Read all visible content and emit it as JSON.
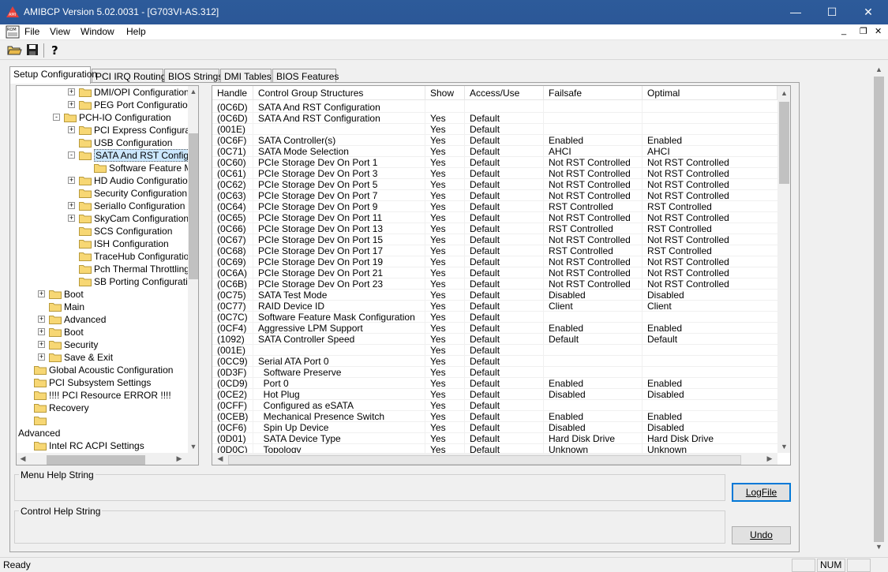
{
  "window": {
    "title": "AMIBCP Version 5.02.0031 - [G703VI-AS.312]",
    "minimize": "—",
    "maximize": "☐",
    "close": "✕",
    "child_min": "_",
    "child_restore": "❐",
    "child_close": "✕"
  },
  "menu": [
    "File",
    "View",
    "Window",
    "Help"
  ],
  "tabs": [
    "Setup Configuration",
    "PCI IRQ Routing",
    "BIOS Strings",
    "DMI Tables",
    "BIOS Features"
  ],
  "tree": [
    {
      "level": 3,
      "pm": "+",
      "label": "DMI/OPI Configuration"
    },
    {
      "level": 3,
      "pm": "+",
      "label": "PEG Port Configuration"
    },
    {
      "level": 2,
      "pm": "-",
      "label": "PCH-IO Configuration",
      "open": true
    },
    {
      "level": 3,
      "pm": "+",
      "label": "PCI Express Configuration"
    },
    {
      "level": 3,
      "pm": "",
      "label": "USB Configuration"
    },
    {
      "level": 3,
      "pm": "-",
      "label": "SATA And RST Configuration",
      "selected": true,
      "open": true
    },
    {
      "level": 4,
      "pm": "",
      "label": "Software Feature Mask C"
    },
    {
      "level": 3,
      "pm": "+",
      "label": "HD Audio Configuration"
    },
    {
      "level": 3,
      "pm": "",
      "label": "Security Configuration"
    },
    {
      "level": 3,
      "pm": "+",
      "label": "SerialIo Configuration"
    },
    {
      "level": 3,
      "pm": "+",
      "label": "SkyCam Configuration"
    },
    {
      "level": 3,
      "pm": "",
      "label": "SCS Configuration"
    },
    {
      "level": 3,
      "pm": "",
      "label": "ISH Configuration"
    },
    {
      "level": 3,
      "pm": "",
      "label": "TraceHub Configuration Men"
    },
    {
      "level": 3,
      "pm": "",
      "label": "Pch Thermal Throttling Contro"
    },
    {
      "level": 3,
      "pm": "",
      "label": "SB Porting Configuration"
    },
    {
      "level": 1,
      "pm": "+",
      "label": "Boot"
    },
    {
      "level": 1,
      "pm": "",
      "label": "Main"
    },
    {
      "level": 1,
      "pm": "+",
      "label": "Advanced"
    },
    {
      "level": 1,
      "pm": "+",
      "label": "Boot"
    },
    {
      "level": 1,
      "pm": "+",
      "label": "Security"
    },
    {
      "level": 1,
      "pm": "+",
      "label": "Save & Exit"
    },
    {
      "level": 0,
      "pm": "",
      "label": "Global Acoustic Configuration"
    },
    {
      "level": 0,
      "pm": "",
      "label": "PCI Subsystem Settings"
    },
    {
      "level": 0,
      "pm": "",
      "label": "!!!! PCI Resource ERROR !!!!"
    },
    {
      "level": 0,
      "pm": "",
      "label": "Recovery"
    },
    {
      "level": 0,
      "pm": "",
      "label": ""
    },
    {
      "level": -1,
      "pm": "",
      "label": "Advanced"
    },
    {
      "level": 0,
      "pm": "",
      "label": "Intel RC ACPI Settings"
    }
  ],
  "grid": {
    "headers": [
      "Handle",
      "Control Group Structures",
      "Show",
      "Access/Use",
      "Failsafe",
      "Optimal"
    ],
    "rows": [
      [
        "(0C6D)",
        "SATA And RST Configuration",
        "",
        "",
        "",
        ""
      ],
      [
        "(0C6D)",
        "SATA And RST Configuration",
        "Yes",
        "Default",
        "",
        ""
      ],
      [
        "(001E)",
        "",
        "Yes",
        "Default",
        "",
        ""
      ],
      [
        "(0C6F)",
        "SATA Controller(s)",
        "Yes",
        "Default",
        "Enabled",
        "Enabled"
      ],
      [
        "(0C71)",
        "SATA Mode Selection",
        "Yes",
        "Default",
        "AHCI",
        "AHCI"
      ],
      [
        "(0C60)",
        "PCIe Storage Dev On Port 1",
        "Yes",
        "Default",
        "Not RST Controlled",
        "Not RST Controlled"
      ],
      [
        "(0C61)",
        "PCIe Storage Dev On Port 3",
        "Yes",
        "Default",
        "Not RST Controlled",
        "Not RST Controlled"
      ],
      [
        "(0C62)",
        "PCIe Storage Dev On Port 5",
        "Yes",
        "Default",
        "Not RST Controlled",
        "Not RST Controlled"
      ],
      [
        "(0C63)",
        "PCIe Storage Dev On Port 7",
        "Yes",
        "Default",
        "Not RST Controlled",
        "Not RST Controlled"
      ],
      [
        "(0C64)",
        "PCIe Storage Dev On Port 9",
        "Yes",
        "Default",
        "RST Controlled",
        "RST Controlled"
      ],
      [
        "(0C65)",
        "PCIe Storage Dev On Port 11",
        "Yes",
        "Default",
        "Not RST Controlled",
        "Not RST Controlled"
      ],
      [
        "(0C66)",
        "PCIe Storage Dev On Port 13",
        "Yes",
        "Default",
        "RST Controlled",
        "RST Controlled"
      ],
      [
        "(0C67)",
        "PCIe Storage Dev On Port 15",
        "Yes",
        "Default",
        "Not RST Controlled",
        "Not RST Controlled"
      ],
      [
        "(0C68)",
        "PCIe Storage Dev On Port 17",
        "Yes",
        "Default",
        "RST Controlled",
        "RST Controlled"
      ],
      [
        "(0C69)",
        "PCIe Storage Dev On Port 19",
        "Yes",
        "Default",
        "Not RST Controlled",
        "Not RST Controlled"
      ],
      [
        "(0C6A)",
        "PCIe Storage Dev On Port 21",
        "Yes",
        "Default",
        "Not RST Controlled",
        "Not RST Controlled"
      ],
      [
        "(0C6B)",
        "PCIe Storage Dev On Port 23",
        "Yes",
        "Default",
        "Not RST Controlled",
        "Not RST Controlled"
      ],
      [
        "(0C75)",
        "SATA Test Mode",
        "Yes",
        "Default",
        "Disabled",
        "Disabled"
      ],
      [
        "(0C77)",
        "RAID Device ID",
        "Yes",
        "Default",
        "Client",
        "Client"
      ],
      [
        "(0C7C)",
        "Software Feature Mask Configuration",
        "Yes",
        "Default",
        "",
        ""
      ],
      [
        "(0CF4)",
        "Aggressive LPM Support",
        "Yes",
        "Default",
        "Enabled",
        "Enabled"
      ],
      [
        "(1092)",
        "SATA Controller Speed",
        "Yes",
        "Default",
        "Default",
        "Default"
      ],
      [
        "(001E)",
        "",
        "Yes",
        "Default",
        "",
        ""
      ],
      [
        "(0CC9)",
        "Serial ATA Port 0",
        "Yes",
        "Default",
        "",
        ""
      ],
      [
        "(0D3F)",
        "  Software Preserve",
        "Yes",
        "Default",
        "",
        ""
      ],
      [
        "(0CD9)",
        "  Port 0",
        "Yes",
        "Default",
        "Enabled",
        "Enabled"
      ],
      [
        "(0CE2)",
        "  Hot Plug",
        "Yes",
        "Default",
        "Disabled",
        "Disabled"
      ],
      [
        "(0CFF)",
        "  Configured as eSATA",
        "Yes",
        "Default",
        "",
        ""
      ],
      [
        "(0CEB)",
        "  Mechanical Presence Switch",
        "Yes",
        "Default",
        "Enabled",
        "Enabled"
      ],
      [
        "(0CF6)",
        "  Spin Up Device",
        "Yes",
        "Default",
        "Disabled",
        "Disabled"
      ],
      [
        "(0D01)",
        "  SATA Device Type",
        "Yes",
        "Default",
        "Hard Disk Drive",
        "Hard Disk Drive"
      ],
      [
        "(0D0C)",
        "  Topology",
        "Yes",
        "Default",
        "Unknown",
        "Unknown"
      ]
    ]
  },
  "help": {
    "menu_label": "Menu Help String",
    "control_label": "Control Help String"
  },
  "buttons": {
    "logfile": "LogFile",
    "undo": "Undo"
  },
  "status": {
    "text": "Ready",
    "num": "NUM"
  },
  "colors": {
    "titlebar": "#2b5797",
    "selection": "#cce8ff"
  }
}
